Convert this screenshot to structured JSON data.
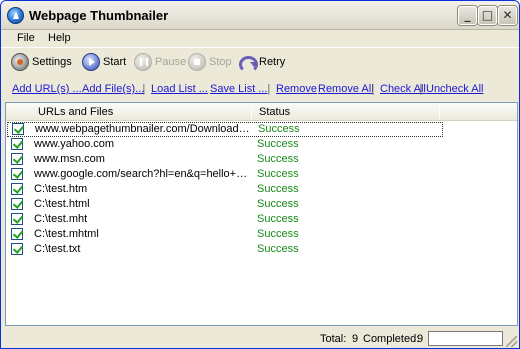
{
  "window": {
    "title": "Webpage Thumbnailer"
  },
  "menu": {
    "file": "File",
    "help": "Help"
  },
  "toolbar": {
    "settings": "Settings",
    "start": "Start",
    "pause": "Pause",
    "stop": "Stop",
    "retry": "Retry"
  },
  "links": {
    "add_urls": "Add URL(s) ...",
    "add_files": "Add File(s)...",
    "load_list": "Load List ...",
    "save_list": "Save List ...",
    "remove": "Remove",
    "remove_all": "Remove All",
    "check_all": "Check All",
    "uncheck_all": "Uncheck All"
  },
  "list": {
    "columns": {
      "urls": "URLs and Files",
      "status": "Status"
    },
    "rows": [
      {
        "url": "www.webpagethumbnailer.com/Download.html",
        "status": "Success",
        "checked": true
      },
      {
        "url": "www.yahoo.com",
        "status": "Success",
        "checked": true
      },
      {
        "url": "www.msn.com",
        "status": "Success",
        "checked": true
      },
      {
        "url": "www.google.com/search?hl=en&q=hello+world&b...",
        "status": "Success",
        "checked": true
      },
      {
        "url": "C:\\test.htm",
        "status": "Success",
        "checked": true
      },
      {
        "url": "C:\\test.html",
        "status": "Success",
        "checked": true
      },
      {
        "url": "C:\\test.mht",
        "status": "Success",
        "checked": true
      },
      {
        "url": "C:\\test.mhtml",
        "status": "Success",
        "checked": true
      },
      {
        "url": "C:\\test.txt",
        "status": "Success",
        "checked": true
      }
    ]
  },
  "status": {
    "total_label": "Total:",
    "total_value": "9",
    "completed_label": "Completed:",
    "completed_value": "9"
  },
  "colors": {
    "success": "#1a8a1a",
    "link": "#1a1ad6"
  }
}
